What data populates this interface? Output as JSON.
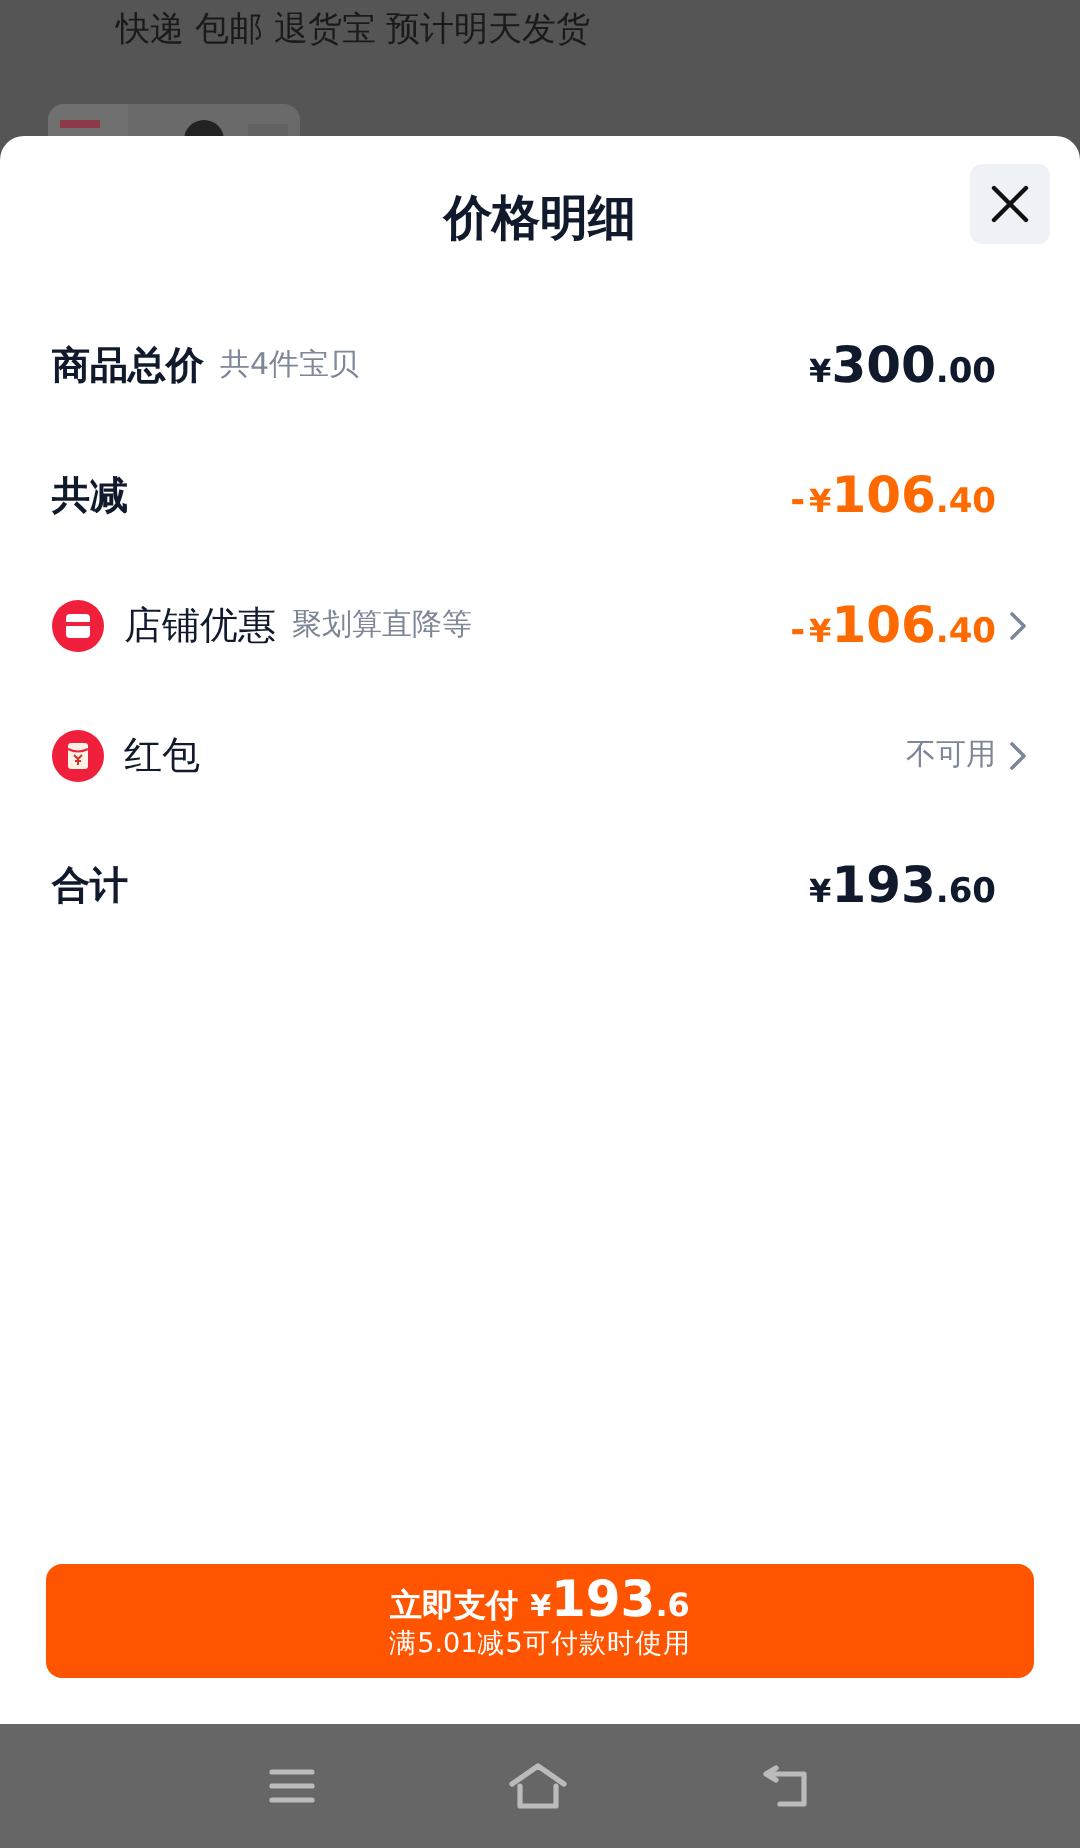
{
  "background": {
    "shipping_line": "快递 包邮 退货宝 预计明天发货"
  },
  "sheet": {
    "title": "价格明细",
    "rows": [
      {
        "kind": "heading",
        "label": "商品总价",
        "note": "共4件宝贝",
        "amount": {
          "currency": "¥",
          "integer": "300",
          "decimal": ".00"
        },
        "highlight": false,
        "chevron": false
      },
      {
        "kind": "heading",
        "label": "共减",
        "amount": {
          "sign": "-",
          "currency": "¥",
          "integer": "106",
          "decimal": ".40"
        },
        "highlight": true,
        "chevron": false
      },
      {
        "kind": "store",
        "label": "店铺优惠",
        "note": "聚划算直降等",
        "amount": {
          "sign": "-",
          "currency": "¥",
          "integer": "106",
          "decimal": ".40"
        },
        "highlight": true,
        "chevron": true
      },
      {
        "kind": "envelope",
        "label": "红包",
        "status": "不可用",
        "chevron": true
      },
      {
        "kind": "heading",
        "label": "合计",
        "amount": {
          "currency": "¥",
          "integer": "193",
          "decimal": ".60"
        },
        "highlight": false,
        "chevron": false
      }
    ],
    "pay_button": {
      "label": "立即支付",
      "currency": "¥",
      "integer": "193",
      "decimal": ".6",
      "note": "满5.01减5可付款时使用"
    }
  }
}
